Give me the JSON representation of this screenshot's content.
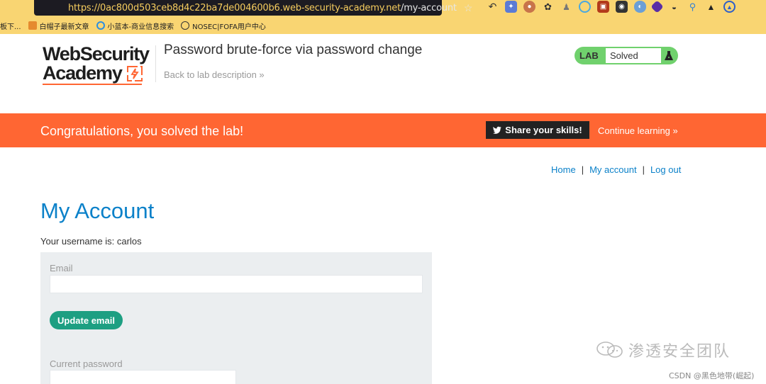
{
  "browser": {
    "url_host": "https://0ac800d503ceb8d4c22ba7de004600b6.web-security-academy.net",
    "url_path": "/my-account",
    "bookmarks": [
      {
        "label": "板下...",
        "icon": "bookmark-icon"
      },
      {
        "label": "白帽子最新文章",
        "icon": "hat-icon"
      },
      {
        "label": "小蓝本-商业信息搜索",
        "icon": "search-icon"
      },
      {
        "label": "NOSEC|FOFA用户中心",
        "icon": "globe-icon"
      }
    ]
  },
  "header": {
    "logo_line1": "WebSecurity",
    "logo_line2": "Academy",
    "lab_title": "Password brute-force via password change",
    "back_link": "Back to lab description",
    "lab_badge": {
      "label": "LAB",
      "status": "Solved"
    }
  },
  "banner": {
    "message": "Congratulations, you solved the lab!",
    "share_label": "Share your skills!",
    "continue_label": "Continue learning"
  },
  "nav": {
    "home": "Home",
    "separator": "|",
    "my_account": "My account",
    "logout": "Log out"
  },
  "main": {
    "title": "My Account",
    "username_text": "Your username is: carlos",
    "email_label": "Email",
    "email_value": "",
    "update_email_label": "Update email",
    "current_password_label": "Current password",
    "current_password_value": ""
  },
  "watermark": {
    "text": "渗透安全团队",
    "csdn": "CSDN @黑色地带(崛起)"
  },
  "colors": {
    "brand_orange": "#ff6633",
    "link_blue": "#0b81c9",
    "solved_green": "#70d16d",
    "button_green": "#1d9f82"
  }
}
